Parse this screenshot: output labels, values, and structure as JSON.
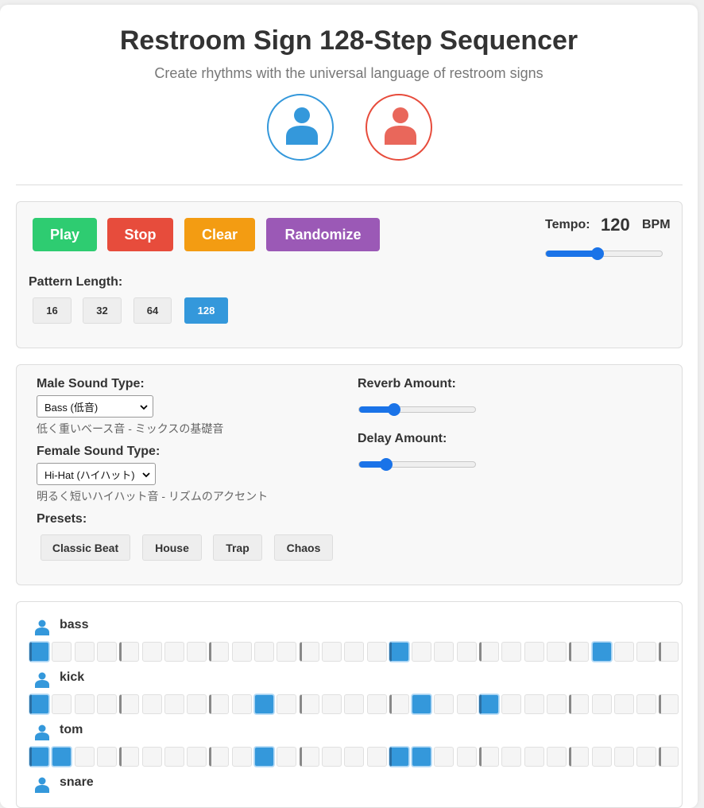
{
  "header": {
    "title": "Restroom Sign 128-Step Sequencer",
    "subtitle": "Create rhythms with the universal language of restroom signs"
  },
  "colors": {
    "male": "#3498db",
    "female": "#e74c3c",
    "play": "#2ecc71",
    "stop": "#e74c3c",
    "clear": "#f39c12",
    "randomize": "#9b59b6",
    "active_length": "#3498db"
  },
  "icons": {
    "male": "male-restroom-icon",
    "female": "female-restroom-icon",
    "track": "person-icon"
  },
  "transport": {
    "play_label": "Play",
    "stop_label": "Stop",
    "clear_label": "Clear",
    "randomize_label": "Randomize"
  },
  "tempo": {
    "label": "Tempo:",
    "value": "120",
    "unit": "BPM",
    "slider_fraction": 0.44
  },
  "pattern": {
    "label": "Pattern Length:",
    "options": [
      "16",
      "32",
      "64",
      "128"
    ],
    "selected": "128"
  },
  "sound": {
    "male_label": "Male Sound Type:",
    "male_value": "Bass (低音)",
    "male_desc": "低く重いベース音 - ミックスの基礎音",
    "female_label": "Female Sound Type:",
    "female_value": "Hi-Hat (ハイハット)",
    "female_desc": "明るく短いハイハット音 - リズムのアクセント",
    "reverb_label": "Reverb Amount:",
    "reverb_fraction": 0.3,
    "delay_label": "Delay Amount:",
    "delay_fraction": 0.23,
    "presets_label": "Presets:",
    "presets": [
      "Classic Beat",
      "House",
      "Trap",
      "Chaos"
    ]
  },
  "tracks": [
    {
      "name": "bass",
      "active_steps": [
        0,
        16,
        25
      ]
    },
    {
      "name": "kick",
      "active_steps": [
        0,
        10,
        17,
        20
      ]
    },
    {
      "name": "tom",
      "active_steps": [
        0,
        1,
        10,
        16,
        17
      ]
    },
    {
      "name": "snare",
      "active_steps": []
    }
  ]
}
